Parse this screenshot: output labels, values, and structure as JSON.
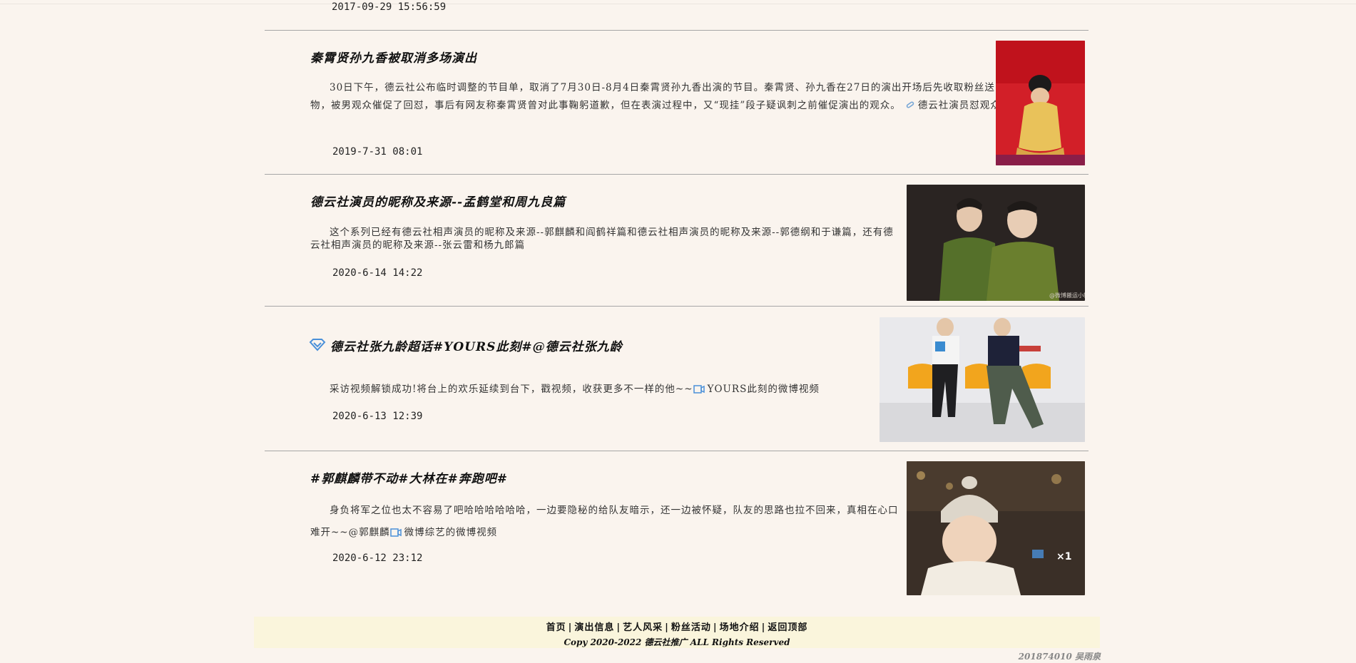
{
  "top_date": "2017-09-29 15:56:59",
  "articles": [
    {
      "title": "秦霄贤孙九香被取消多场演出",
      "summary": "30日下午，德云社公布临时调整的节目单，取消了7月30日-8月4日秦霄贤孙九香出演的节目。秦霄贤、孙九香在27日的演出开场后先收取粉丝送的信及礼物，被男观众催促了回怼，事后有网友称秦霄贤曾对此事鞠躬道歉，但在表演过程中，又“现挂”段子疑讽刺之前催促演出的观众。",
      "link_text": "德云社演员怼观众引争议",
      "link_icon": "link-icon",
      "date": "2019-7-31 08:01",
      "image_alt": "performer on red stage"
    },
    {
      "title": "德云社演员的昵称及来源--孟鹤堂和周九良篇",
      "summary": "这个系列已经有德云社相声演员的昵称及来源--郭麒麟和阎鹤祥篇和德云社相声演员的昵称及来源--郭德纲和于谦篇，还有德云社相声演员的昵称及来源--张云雷和杨九郎篇",
      "date": "2020-6-14 14:22",
      "image_alt": "two performers in green robes",
      "image_watermark": "@微博搬运小帽"
    },
    {
      "title": "德云社张九龄超话#YOURS此刻#@德云社张九龄",
      "title_icon": "diamond-icon",
      "summary": "采访视频解锁成功!将台上的欢乐延续到台下，戳视频，收获更多不一样的他~~",
      "link_text": "YOURS此刻的微博视频",
      "link_icon": "video-icon",
      "date": "2020-6-13 12:39",
      "image_alt": "two men seated on orange chairs"
    },
    {
      "title": "#郭麒麟带不动#大林在#奔跑吧#",
      "summary": "身负将军之位也太不容易了吧哈哈哈哈哈哈，一边要隐秘的给队友暗示，还一边被怀疑，队友的思路也拉不回来，真相在心口难开~~@郭麒麟",
      "link_text": "微博综艺的微博视频",
      "link_icon": "video-icon",
      "date": "2020-6-12 23:12",
      "image_alt": "man wearing knit hat on variety show"
    }
  ],
  "footer": {
    "nav": [
      "首页",
      "演出信息",
      "艺人风采",
      "粉丝活动",
      "场地介绍",
      "返回顶部"
    ],
    "copyright": "Copy 2020-2022 德云社推广 ALL Rights Reserved"
  },
  "signature": "201874010 吴雨泉",
  "colors": {
    "page_bg": "#faf4ee",
    "footer_bg": "#faf5dc",
    "separator": "#a6a6a6",
    "icon_blue": "#4a90d9"
  }
}
